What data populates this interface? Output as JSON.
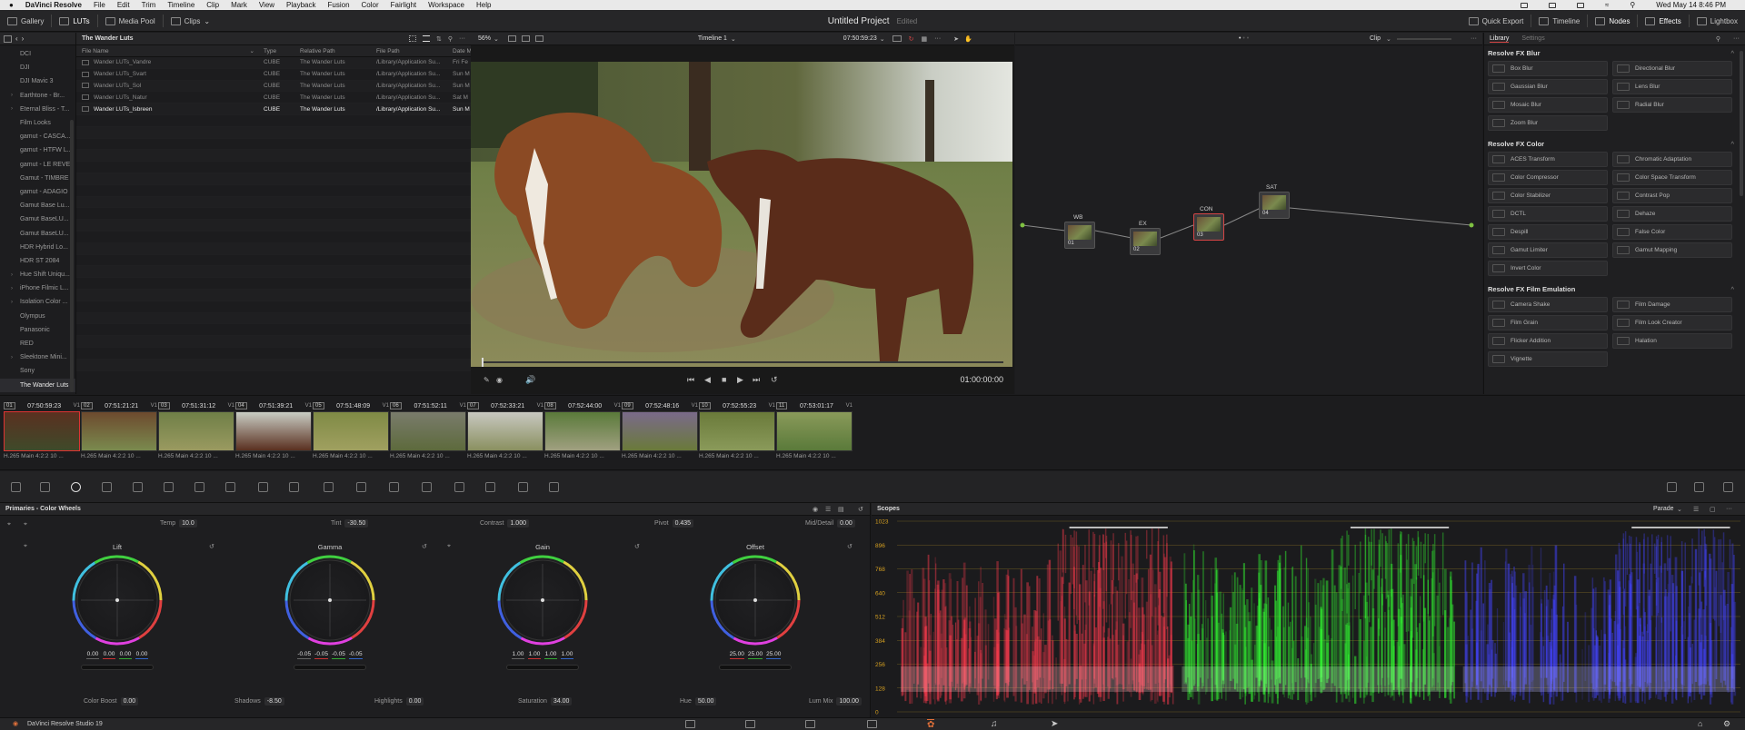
{
  "mac_menu": {
    "apple": "",
    "app": "DaVinci Resolve",
    "items": [
      "File",
      "Edit",
      "Trim",
      "Timeline",
      "Clip",
      "Mark",
      "View",
      "Playback",
      "Fusion",
      "Color",
      "Fairlight",
      "Workspace",
      "Help"
    ],
    "clock": "Wed May 14  8:46 PM"
  },
  "toolbar": {
    "left": [
      "Gallery",
      "LUTs",
      "Media Pool",
      "Clips"
    ],
    "project_title": "Untitled Project",
    "project_state": "Edited",
    "right": [
      "Quick Export",
      "Timeline",
      "Nodes",
      "Effects",
      "Lightbox"
    ]
  },
  "bins": {
    "header": "The Wander Luts",
    "items": [
      {
        "label": "DCI",
        "expand": false
      },
      {
        "label": "DJI",
        "expand": false
      },
      {
        "label": "DJI Mavic 3",
        "expand": false
      },
      {
        "label": "Earthtone - Br...",
        "expand": true
      },
      {
        "label": "Eternal Bliss - T...",
        "expand": true
      },
      {
        "label": "Film Looks",
        "expand": false
      },
      {
        "label": "gamut - CASCA...",
        "expand": false
      },
      {
        "label": "gamut - HTFW L...",
        "expand": false
      },
      {
        "label": "gamut - LE REVE",
        "expand": false
      },
      {
        "label": "Gamut - TIMBRE",
        "expand": false
      },
      {
        "label": "gamut - ADAGIO",
        "expand": false
      },
      {
        "label": "Gamut Base Lu...",
        "expand": false
      },
      {
        "label": "Gamut BaseLU...",
        "expand": false
      },
      {
        "label": "Gamut BaseLU...",
        "expand": false
      },
      {
        "label": "HDR Hybrid Lo...",
        "expand": false
      },
      {
        "label": "HDR ST 2084",
        "expand": false
      },
      {
        "label": "Hue Shift Uniqu...",
        "expand": true
      },
      {
        "label": "iPhone Filmic L...",
        "expand": true
      },
      {
        "label": "Isolation Color ...",
        "expand": true
      },
      {
        "label": "Olympus",
        "expand": false
      },
      {
        "label": "Panasonic",
        "expand": false
      },
      {
        "label": "RED",
        "expand": false
      },
      {
        "label": "Sleektone Mini...",
        "expand": true
      },
      {
        "label": "Sony",
        "expand": false
      },
      {
        "label": "The Wander Luts",
        "expand": false,
        "selected": true
      }
    ]
  },
  "lut_list": {
    "columns": [
      "File Name",
      "Type",
      "Relative Path",
      "File Path",
      "Date M"
    ],
    "rows": [
      {
        "name": "Wander LUTs_Vandre",
        "type": "CUBE",
        "rel": "The Wander Luts",
        "path": "/Library/Application Su...",
        "date": "Fri Fe"
      },
      {
        "name": "Wander LUTs_Svart",
        "type": "CUBE",
        "rel": "The Wander Luts",
        "path": "/Library/Application Su...",
        "date": "Sun M"
      },
      {
        "name": "Wander LUTs_Sol",
        "type": "CUBE",
        "rel": "The Wander Luts",
        "path": "/Library/Application Su...",
        "date": "Sun M"
      },
      {
        "name": "Wander LUTs_Natur",
        "type": "CUBE",
        "rel": "The Wander Luts",
        "path": "/Library/Application Su...",
        "date": "Sat M"
      },
      {
        "name": "Wander LUTs_Isbreen",
        "type": "CUBE",
        "rel": "The Wander Luts",
        "path": "/Library/Application Su...",
        "date": "Sun M",
        "selected": true
      }
    ]
  },
  "viewer": {
    "zoom": "56%",
    "timeline": "Timeline 1",
    "timecode": "07:50:59:23",
    "playhead_tc": "01:00:00:00"
  },
  "node_editor": {
    "mode": "Clip",
    "nodes": [
      {
        "label": "WB",
        "num": "01"
      },
      {
        "label": "EX",
        "num": "02"
      },
      {
        "label": "CON",
        "num": "03"
      },
      {
        "label": "SAT",
        "num": "04"
      }
    ]
  },
  "library": {
    "tabs": [
      "Library",
      "Settings"
    ],
    "sections": [
      {
        "title": "Resolve FX Blur",
        "items": [
          "Box Blur",
          "Directional Blur",
          "Gaussian Blur",
          "Lens Blur",
          "Mosaic Blur",
          "Radial Blur",
          "Zoom Blur"
        ]
      },
      {
        "title": "Resolve FX Color",
        "items": [
          "ACES Transform",
          "Chromatic Adaptation",
          "Color Compressor",
          "Color Space Transform",
          "Color Stabilizer",
          "Contrast Pop",
          "DCTL",
          "Dehaze",
          "Despill",
          "False Color",
          "Gamut Limiter",
          "Gamut Mapping",
          "Invert Color"
        ]
      },
      {
        "title": "Resolve FX Film Emulation",
        "items": [
          "Camera Shake",
          "Film Damage",
          "Film Grain",
          "Film Look Creator",
          "Flicker Addition",
          "Halation",
          "Vignette"
        ]
      }
    ]
  },
  "clips": [
    {
      "num": "01",
      "tc": "07:50:59:23",
      "track": "V1",
      "name": "H.265 Main 4:2:2 10 ...",
      "selected": true
    },
    {
      "num": "02",
      "tc": "07:51:21:21",
      "track": "V1",
      "name": "H.265 Main 4:2:2 10 ..."
    },
    {
      "num": "03",
      "tc": "07:51:31:12",
      "track": "V1",
      "name": "H.265 Main 4:2:2 10 ..."
    },
    {
      "num": "04",
      "tc": "07:51:39:21",
      "track": "V1",
      "name": "H.265 Main 4:2:2 10 ..."
    },
    {
      "num": "05",
      "tc": "07:51:48:09",
      "track": "V1",
      "name": "H.265 Main 4:2:2 10 ..."
    },
    {
      "num": "06",
      "tc": "07:51:52:11",
      "track": "V1",
      "name": "H.265 Main 4:2:2 10 ..."
    },
    {
      "num": "07",
      "tc": "07:52:33:21",
      "track": "V1",
      "name": "H.265 Main 4:2:2 10 ..."
    },
    {
      "num": "08",
      "tc": "07:52:44:00",
      "track": "V1",
      "name": "H.265 Main 4:2:2 10 ..."
    },
    {
      "num": "09",
      "tc": "07:52:48:16",
      "track": "V1",
      "name": "H.265 Main 4:2:2 10 ..."
    },
    {
      "num": "10",
      "tc": "07:52:55:23",
      "track": "V1",
      "name": "H.265 Main 4:2:2 10 ..."
    },
    {
      "num": "11",
      "tc": "07:53:01:17",
      "track": "V1",
      "name": "H.265 Main 4:2:2 10 ..."
    }
  ],
  "primaries": {
    "title": "Primaries - Color Wheels",
    "top_params": [
      {
        "label": "Temp",
        "value": "10.0"
      },
      {
        "label": "Tint",
        "value": "-30.50"
      },
      {
        "label": "Contrast",
        "value": "1.000"
      },
      {
        "label": "Pivot",
        "value": "0.435"
      },
      {
        "label": "Mid/Detail",
        "value": "0.00"
      }
    ],
    "wheels": [
      {
        "title": "Lift",
        "values": [
          "0.00",
          "0.00",
          "0.00",
          "0.00"
        ]
      },
      {
        "title": "Gamma",
        "values": [
          "-0.05",
          "-0.05",
          "-0.05",
          "-0.05"
        ]
      },
      {
        "title": "Gain",
        "values": [
          "1.00",
          "1.00",
          "1.00",
          "1.00"
        ]
      },
      {
        "title": "Offset",
        "values": [
          "25.00",
          "25.00",
          "25.00"
        ]
      }
    ],
    "bottom_params": [
      {
        "label": "Color Boost",
        "value": "0.00"
      },
      {
        "label": "Shadows",
        "value": "-8.50"
      },
      {
        "label": "Highlights",
        "value": "0.00"
      },
      {
        "label": "Saturation",
        "value": "34.00"
      },
      {
        "label": "Hue",
        "value": "50.00"
      },
      {
        "label": "Lum Mix",
        "value": "100.00"
      }
    ]
  },
  "scopes": {
    "title": "Scopes",
    "mode": "Parade",
    "ticks": [
      "1023",
      "896",
      "768",
      "640",
      "512",
      "384",
      "256",
      "128",
      "0"
    ]
  },
  "status": {
    "app": "DaVinci Resolve Studio 19"
  },
  "colors": {
    "accent": "#d64545",
    "selected_page": "#e0703a"
  }
}
